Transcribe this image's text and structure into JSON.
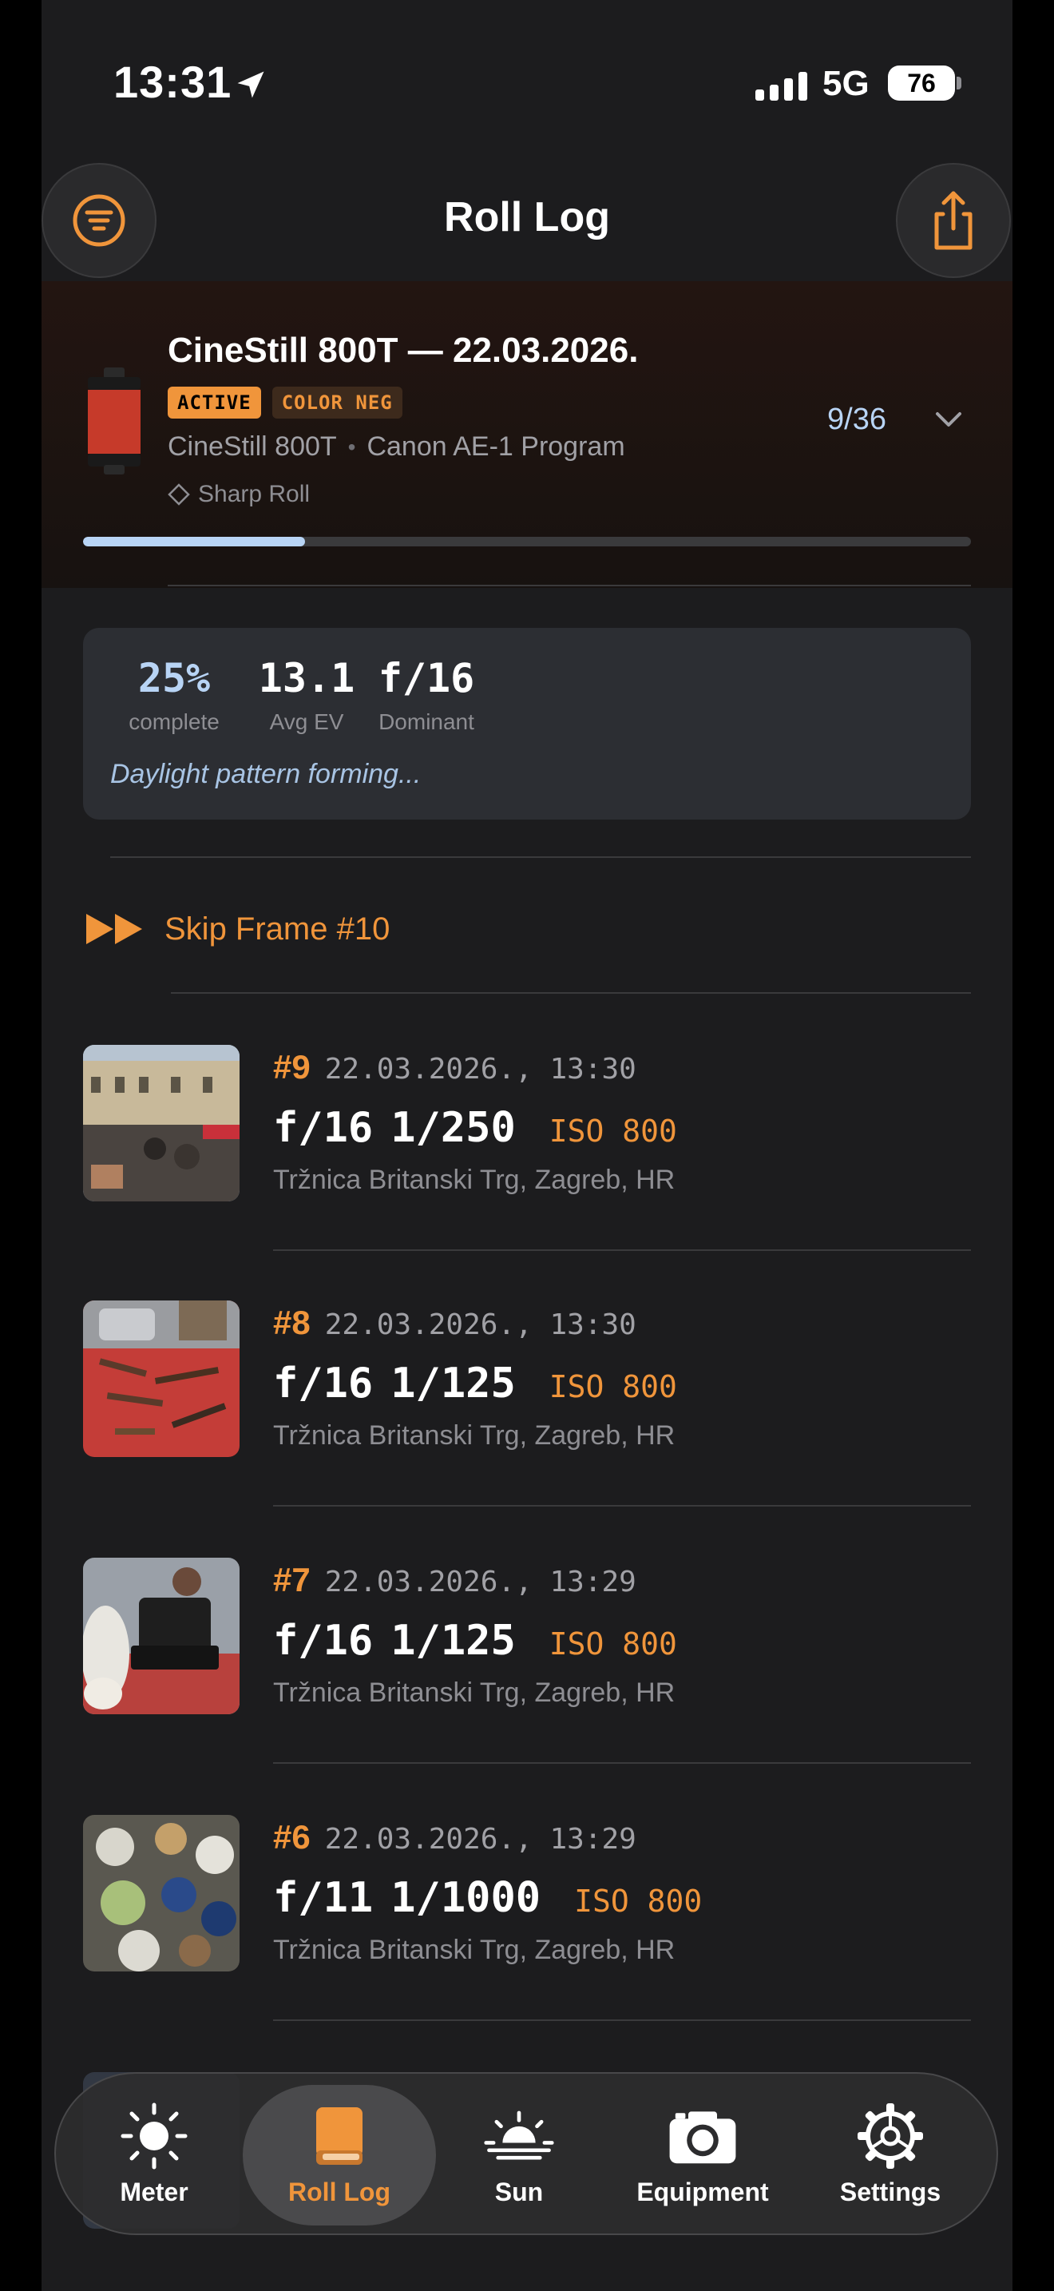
{
  "status_bar": {
    "time": "13:31",
    "network": "5G",
    "battery": "76"
  },
  "header": {
    "title": "Roll Log",
    "filter_icon": "filter-icon",
    "share_icon": "share-icon"
  },
  "roll": {
    "title": "CineStill 800T — 22.03.2026.",
    "badges": [
      "ACTIVE",
      "COLOR NEG"
    ],
    "film": "CineStill 800T",
    "camera": "Canon AE-1 Program",
    "tag": "Sharp Roll",
    "count": "9/36",
    "progress": 0.25
  },
  "stats": {
    "complete_value": "25%",
    "complete_label": "complete",
    "avg_ev_value": "13.1",
    "avg_ev_label": "Avg EV",
    "dominant_value": "f/16",
    "dominant_label": "Dominant",
    "insight": "Daylight pattern forming..."
  },
  "skip": {
    "label": "Skip Frame #10"
  },
  "frames": [
    {
      "number": "#9",
      "datetime": "22.03.2026., 13:30",
      "aperture": "f/16",
      "shutter": "1/250",
      "iso": "ISO 800",
      "location": "Tržnica Britanski Trg, Zagreb, HR"
    },
    {
      "number": "#8",
      "datetime": "22.03.2026., 13:30",
      "aperture": "f/16",
      "shutter": "1/125",
      "iso": "ISO 800",
      "location": "Tržnica Britanski Trg, Zagreb, HR"
    },
    {
      "number": "#7",
      "datetime": "22.03.2026., 13:29",
      "aperture": "f/16",
      "shutter": "1/125",
      "iso": "ISO 800",
      "location": "Tržnica Britanski Trg, Zagreb, HR"
    },
    {
      "number": "#6",
      "datetime": "22.03.2026., 13:29",
      "aperture": "f/11",
      "shutter": "1/1000",
      "iso": "ISO 800",
      "location": "Tržnica Britanski Trg, Zagreb, HR"
    }
  ],
  "tabs": [
    {
      "label": "Meter",
      "icon": "sun-icon"
    },
    {
      "label": "Roll Log",
      "icon": "book-icon",
      "active": true
    },
    {
      "label": "Sun",
      "icon": "sunset-icon"
    },
    {
      "label": "Equipment",
      "icon": "camera-icon"
    },
    {
      "label": "Settings",
      "icon": "gear-icon"
    }
  ],
  "colors": {
    "accent": "#f0953b",
    "highlight_blue": "#b8d4f5",
    "background": "#1c1c1e"
  }
}
